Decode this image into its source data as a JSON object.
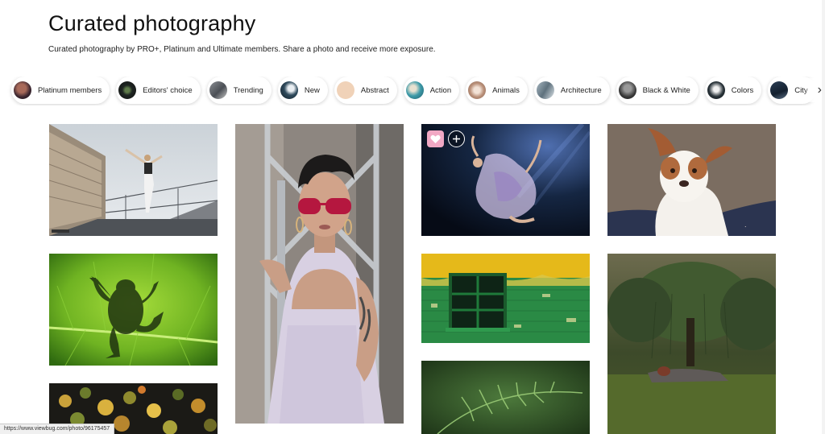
{
  "header": {
    "title": "Curated photography",
    "subtitle": "Curated photography by PRO+, Platinum and Ultimate members. Share a photo and receive more exposure."
  },
  "categories": [
    {
      "label": "Platinum members",
      "icon": "avatar-thumb"
    },
    {
      "label": "Editors' choice",
      "icon": "eye-thumb"
    },
    {
      "label": "Trending",
      "icon": "photo-thumb"
    },
    {
      "label": "New",
      "icon": "photo-thumb"
    },
    {
      "label": "Abstract",
      "icon": "photo-thumb"
    },
    {
      "label": "Action",
      "icon": "photo-thumb"
    },
    {
      "label": "Animals",
      "icon": "photo-thumb"
    },
    {
      "label": "Architecture",
      "icon": "photo-thumb"
    },
    {
      "label": "Black & White",
      "icon": "photo-thumb"
    },
    {
      "label": "Colors",
      "icon": "photo-thumb"
    },
    {
      "label": "City",
      "icon": "photo-thumb"
    }
  ],
  "photos": [
    {
      "subject": "dancer-on-bridge"
    },
    {
      "subject": "frog-on-leaf"
    },
    {
      "subject": "autumn-forest-aerial"
    },
    {
      "subject": "woman-pink-sunglasses"
    },
    {
      "subject": "underwater-dancer"
    },
    {
      "subject": "green-yellow-wall-window"
    },
    {
      "subject": "fern-leaves"
    },
    {
      "subject": "australian-shepherd-dog"
    },
    {
      "subject": "forest-sleeping-woman"
    }
  ],
  "status_url": "https://www.viewbug.com/photo/96175457",
  "colors": {
    "accent_like": "#f1a8c4"
  }
}
